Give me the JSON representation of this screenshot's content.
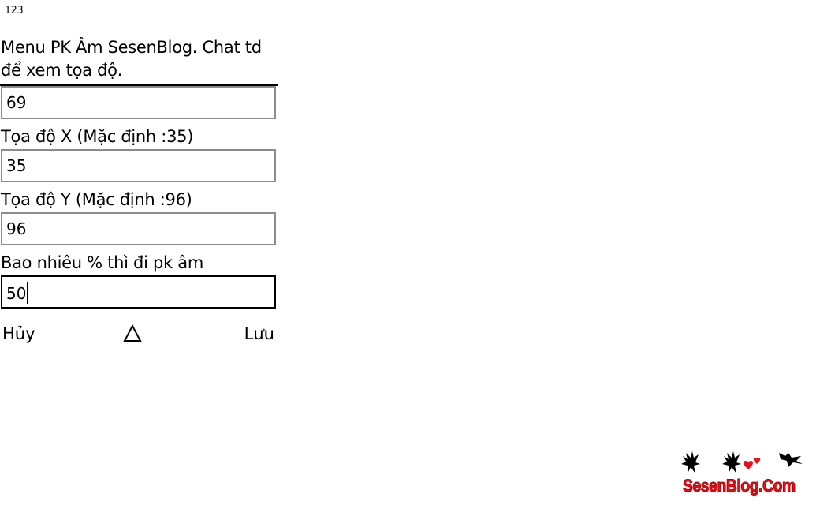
{
  "input_mode": "123",
  "instruction": "Menu PK Âm SesenBlog. Chat td để xem tọa độ.",
  "fields": [
    {
      "value": "69"
    },
    {
      "label": "Tọa độ X (Mặc định :35)",
      "value": "35"
    },
    {
      "label": "Tọa độ Y (Mặc định :96)",
      "value": "96"
    },
    {
      "label": "Bao nhiêu % thì đi pk âm",
      "value": "50"
    }
  ],
  "softkeys": {
    "left": "Hủy",
    "center_icon": "triangle-up-icon",
    "right": "Lưu"
  },
  "watermark": {
    "text": "SesenBlog.Com",
    "color": "#e8121b",
    "heart_color": "#e8121b"
  }
}
